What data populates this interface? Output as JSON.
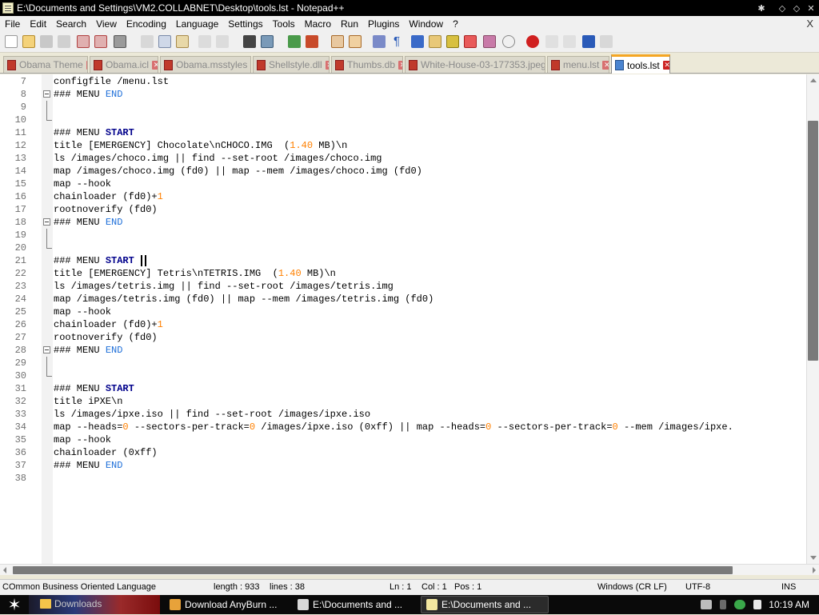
{
  "window": {
    "title": "E:\\Documents and Settings\\VM2.COLLABNET\\Desktop\\tools.lst - Notepad++",
    "controls": [
      "✱",
      "◇",
      "◇",
      "✕"
    ]
  },
  "menu": {
    "items": [
      "File",
      "Edit",
      "Search",
      "View",
      "Encoding",
      "Language",
      "Settings",
      "Tools",
      "Macro",
      "Run",
      "Plugins",
      "Window",
      "?"
    ],
    "close": "X"
  },
  "tabs": [
    {
      "label": "Obama Theme",
      "active": false
    },
    {
      "label": "Obama.icl",
      "active": false
    },
    {
      "label": "Obama.msstyles",
      "active": false
    },
    {
      "label": "Shellstyle.dll",
      "active": false
    },
    {
      "label": "Thumbs.db",
      "active": false
    },
    {
      "label": "White-House-03-177353.jpeg",
      "active": false
    },
    {
      "label": "menu.lst",
      "active": false
    },
    {
      "label": "tools.lst",
      "active": true
    }
  ],
  "tab_close_glyph": "✕",
  "editor": {
    "lines": [
      {
        "n": "7",
        "segs": [
          {
            "t": "configfile /menu.lst",
            "c": "plain"
          }
        ]
      },
      {
        "n": "8",
        "fold": "open",
        "segs": [
          {
            "t": "### MENU ",
            "c": "plain"
          },
          {
            "t": "END",
            "c": "kw2"
          }
        ]
      },
      {
        "n": "9",
        "fold": "line",
        "segs": []
      },
      {
        "n": "10",
        "fold": "end",
        "segs": []
      },
      {
        "n": "11",
        "segs": [
          {
            "t": "### MENU ",
            "c": "plain"
          },
          {
            "t": "START",
            "c": "kw"
          }
        ]
      },
      {
        "n": "12",
        "segs": [
          {
            "t": "title [EMERGENCY] Chocolate\\nCHOCO.IMG  (",
            "c": "plain"
          },
          {
            "t": "1.40",
            "c": "num"
          },
          {
            "t": " MB)\\n",
            "c": "plain"
          }
        ]
      },
      {
        "n": "13",
        "segs": [
          {
            "t": "ls /images/choco.img || find --set-root /images/choco.img",
            "c": "plain"
          }
        ]
      },
      {
        "n": "14",
        "segs": [
          {
            "t": "map /images/choco.img (fd0) || map --mem /images/choco.img (fd0)",
            "c": "plain"
          }
        ]
      },
      {
        "n": "15",
        "segs": [
          {
            "t": "map --hook",
            "c": "plain"
          }
        ]
      },
      {
        "n": "16",
        "segs": [
          {
            "t": "chainloader (fd0)+",
            "c": "plain"
          },
          {
            "t": "1",
            "c": "num"
          }
        ]
      },
      {
        "n": "17",
        "segs": [
          {
            "t": "rootnoverify (fd0)",
            "c": "plain"
          }
        ]
      },
      {
        "n": "18",
        "fold": "open",
        "segs": [
          {
            "t": "### MENU ",
            "c": "plain"
          },
          {
            "t": "END",
            "c": "kw2"
          }
        ]
      },
      {
        "n": "19",
        "fold": "line",
        "segs": []
      },
      {
        "n": "20",
        "fold": "end",
        "segs": []
      },
      {
        "n": "21",
        "cursor": true,
        "segs": [
          {
            "t": "### MENU ",
            "c": "plain"
          },
          {
            "t": "START",
            "c": "kw"
          }
        ]
      },
      {
        "n": "22",
        "segs": [
          {
            "t": "title [EMERGENCY] Tetris\\nTETRIS.IMG  (",
            "c": "plain"
          },
          {
            "t": "1.40",
            "c": "num"
          },
          {
            "t": " MB)\\n",
            "c": "plain"
          }
        ]
      },
      {
        "n": "23",
        "segs": [
          {
            "t": "ls /images/tetris.img || find --set-root /images/tetris.img",
            "c": "plain"
          }
        ]
      },
      {
        "n": "24",
        "segs": [
          {
            "t": "map /images/tetris.img (fd0) || map --mem /images/tetris.img (fd0)",
            "c": "plain"
          }
        ]
      },
      {
        "n": "25",
        "segs": [
          {
            "t": "map --hook",
            "c": "plain"
          }
        ]
      },
      {
        "n": "26",
        "segs": [
          {
            "t": "chainloader (fd0)+",
            "c": "plain"
          },
          {
            "t": "1",
            "c": "num"
          }
        ]
      },
      {
        "n": "27",
        "segs": [
          {
            "t": "rootnoverify (fd0)",
            "c": "plain"
          }
        ]
      },
      {
        "n": "28",
        "fold": "open",
        "segs": [
          {
            "t": "### MENU ",
            "c": "plain"
          },
          {
            "t": "END",
            "c": "kw2"
          }
        ]
      },
      {
        "n": "29",
        "fold": "line",
        "segs": []
      },
      {
        "n": "30",
        "fold": "end",
        "segs": []
      },
      {
        "n": "31",
        "segs": [
          {
            "t": "### MENU ",
            "c": "plain"
          },
          {
            "t": "START",
            "c": "kw"
          }
        ]
      },
      {
        "n": "32",
        "segs": [
          {
            "t": "title iPXE\\n",
            "c": "plain"
          }
        ]
      },
      {
        "n": "33",
        "segs": [
          {
            "t": "ls /images/ipxe.iso || find --set-root /images/ipxe.iso",
            "c": "plain"
          }
        ]
      },
      {
        "n": "34",
        "segs": [
          {
            "t": "map --heads=",
            "c": "plain"
          },
          {
            "t": "0",
            "c": "num"
          },
          {
            "t": " --sectors-per-track=",
            "c": "plain"
          },
          {
            "t": "0",
            "c": "num"
          },
          {
            "t": " /images/ipxe.iso (0xff) || map --heads=",
            "c": "plain"
          },
          {
            "t": "0",
            "c": "num"
          },
          {
            "t": " --sectors-per-track=",
            "c": "plain"
          },
          {
            "t": "0",
            "c": "num"
          },
          {
            "t": " --mem /images/ipxe.",
            "c": "plain"
          }
        ]
      },
      {
        "n": "35",
        "segs": [
          {
            "t": "map --hook",
            "c": "plain"
          }
        ]
      },
      {
        "n": "36",
        "segs": [
          {
            "t": "chainloader (0xff)",
            "c": "plain"
          }
        ]
      },
      {
        "n": "37",
        "segs": [
          {
            "t": "### MENU ",
            "c": "plain"
          },
          {
            "t": "END",
            "c": "kw2"
          }
        ]
      },
      {
        "n": "38",
        "segs": []
      }
    ]
  },
  "statusbar": {
    "language": "COmmon Business Oriented Language",
    "length": "length : 933",
    "lines": "lines : 38",
    "ln": "Ln : 1",
    "col": "Col : 1",
    "pos": "Pos : 1",
    "eol": "Windows (CR LF)",
    "encoding": "UTF-8",
    "mode": "INS"
  },
  "taskbar": {
    "start_glyph": "✶",
    "quick_label": "Downloads",
    "tasks": [
      {
        "label": "Download AnyBurn ...",
        "active": false,
        "icon_color": "#e8a23a"
      },
      {
        "label": "E:\\Documents and ...",
        "active": false,
        "icon_color": "#d8d8d8"
      },
      {
        "label": "E:\\Documents and ...",
        "active": true,
        "icon_color": "#f3e7a0"
      }
    ],
    "clock": "10:19 AM"
  },
  "colors": {
    "keyword_start": "#00008b",
    "keyword_end": "#1e6fd9",
    "number": "#ff8000",
    "active_tab_accent": "#f5a623"
  }
}
